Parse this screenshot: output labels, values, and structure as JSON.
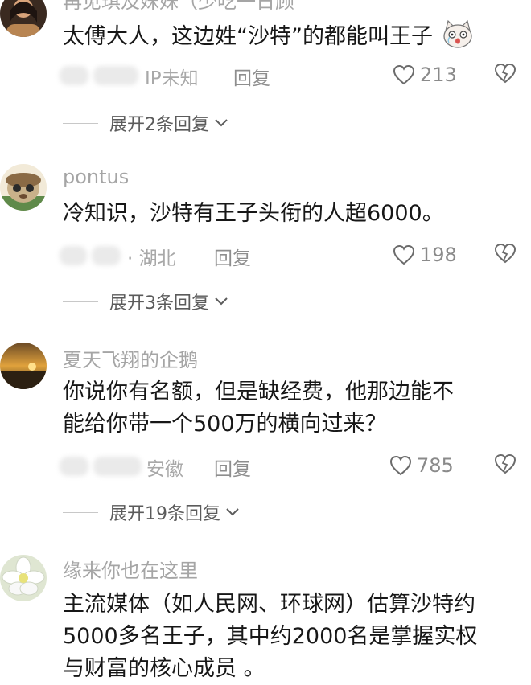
{
  "comments": [
    {
      "username": "再见琪及妹妹（少吃一日顾",
      "lines": [
        "太傅大人，这边姓“沙特”的都能叫王子"
      ],
      "location": "IP未知",
      "reply_label": "回复",
      "likes": "213",
      "expand_label": "展开2条回复",
      "emoji": "cat-emoji-icon"
    },
    {
      "username": "pontus",
      "lines": [
        "冷知识，沙特有王子头衔的人超6000。"
      ],
      "location": "· 湖北",
      "reply_label": "回复",
      "likes": "198",
      "expand_label": "展开3条回复"
    },
    {
      "username": "夏天飞翔的企鹅",
      "lines": [
        "你说你有名额，但是缺经费，他那边能不",
        "能给你带一个500万的横向过来？"
      ],
      "location": "安徽",
      "reply_label": "回复",
      "likes": "785",
      "expand_label": "展开19条回复"
    },
    {
      "username": "缘来你也在这里",
      "lines": [
        "主流媒体（如人民网、环球网）估算沙特约",
        "5000多名王子，其中约2000名是掌握实权",
        "与财富的核心成员 。"
      ]
    }
  ],
  "colors": {
    "text": "#171717",
    "muted": "#a5a5a5",
    "icon": "#6b6b6b"
  }
}
